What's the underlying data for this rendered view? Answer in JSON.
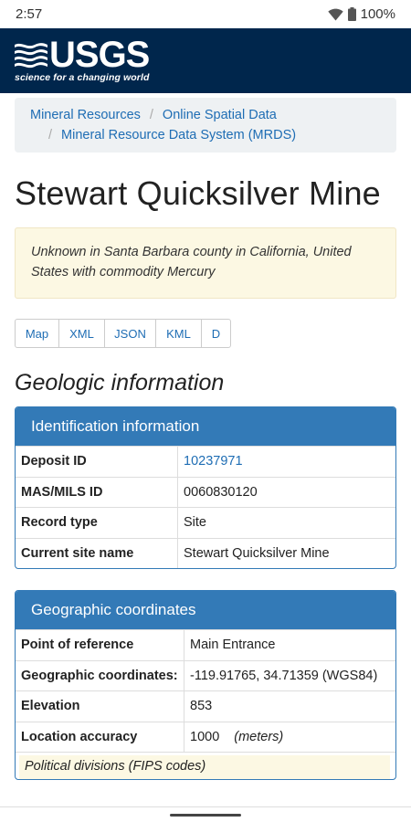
{
  "status": {
    "time": "2:57",
    "battery": "100%"
  },
  "header": {
    "logo_text": "USGS",
    "tagline": "science for a changing world"
  },
  "breadcrumb": {
    "items": [
      "Mineral Resources",
      "Online Spatial Data",
      "Mineral Resource Data System (MRDS)"
    ],
    "separator": "/"
  },
  "page": {
    "title": "Stewart Quicksilver Mine",
    "summary": "Unknown in Santa Barbara county in California, United States with commodity Mercury"
  },
  "formats": [
    "Map",
    "XML",
    "JSON",
    "KML",
    "D"
  ],
  "section_heading": "Geologic information",
  "identification": {
    "heading": "Identification information",
    "rows": [
      {
        "key": "Deposit ID",
        "value": "10237971"
      },
      {
        "key": "MAS/MILS ID",
        "value": "0060830120"
      },
      {
        "key": "Record type",
        "value": "Site"
      },
      {
        "key": "Current site name",
        "value": "Stewart Quicksilver Mine"
      }
    ]
  },
  "geographic": {
    "heading": "Geographic coordinates",
    "rows": [
      {
        "key": "Point of reference",
        "value": "Main Entrance"
      },
      {
        "key": "Geographic coordinates:",
        "value": "-119.91765, 34.71359 (WGS84)"
      },
      {
        "key": "Elevation",
        "value": "853"
      },
      {
        "key": "Location accuracy",
        "value": "1000",
        "unit": "(meters)"
      }
    ],
    "sub_heading": "Political divisions (FIPS codes)"
  },
  "colors": {
    "header_bg": "#00264c",
    "panel_blue": "#337ab7",
    "link": "#1e6db4",
    "note_bg": "#fcf8e3"
  },
  "icons": [
    "wifi-icon",
    "battery-icon",
    "usgs-logo-mark"
  ]
}
